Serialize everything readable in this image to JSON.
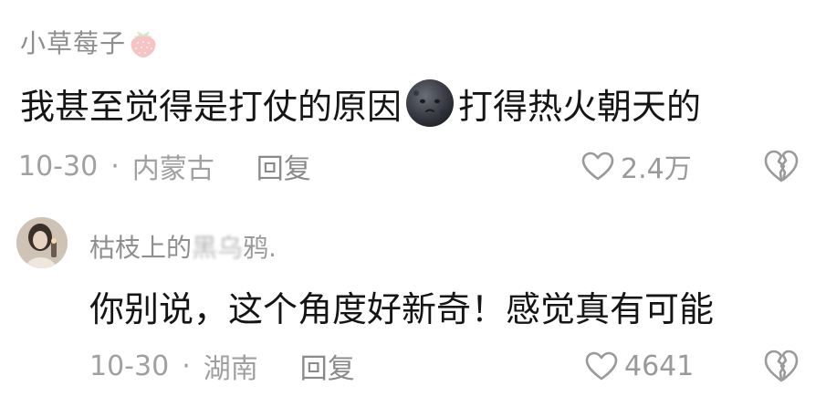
{
  "comments": [
    {
      "username": "小草莓子",
      "username_emoji": "strawberry-icon",
      "text_before_emoji": "我甚至觉得是打仗的原因",
      "inline_emoji": "moon-face-icon",
      "text_after_emoji": "打得热火朝天的",
      "date": "10-30",
      "separator": "·",
      "location": "内蒙古",
      "reply_label": "回复",
      "like_count": "2.4万"
    },
    {
      "username_visible": "枯枝上的",
      "username_obscured": "黑乌",
      "username_tail": "鸦.",
      "text": "你别说，这个角度好新奇！感觉真有可能",
      "date": "10-30",
      "separator": "·",
      "location": "湖南",
      "reply_label": "回复",
      "like_count": "4641"
    }
  ],
  "colors": {
    "username": "#8e8e8e",
    "body_text": "#151515",
    "meta_text": "#a0a0a0",
    "icon_stroke": "#9a9a9a"
  }
}
